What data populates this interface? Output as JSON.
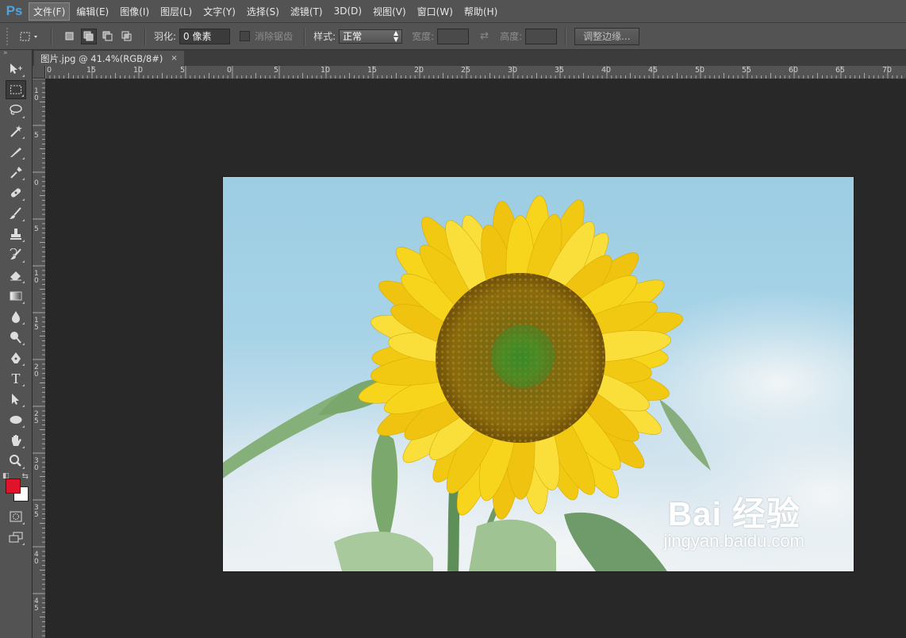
{
  "app": {
    "logo": "Ps",
    "menus": [
      "文件(F)",
      "编辑(E)",
      "图像(I)",
      "图层(L)",
      "文字(Y)",
      "选择(S)",
      "滤镜(T)",
      "3D(D)",
      "视图(V)",
      "窗口(W)",
      "帮助(H)"
    ]
  },
  "options": {
    "feather_label": "羽化:",
    "feather_value": "0 像素",
    "antialias_label": "消除锯齿",
    "style_label": "样式:",
    "style_value": "正常",
    "width_label": "宽度:",
    "height_label": "高度:",
    "refine_edge_label": "调整边缘..."
  },
  "panel_strip": {
    "collapse_glyph": "»"
  },
  "document": {
    "tab_title": "图片.jpg @ 41.4%(RGB/8#)",
    "close_glyph": "×"
  },
  "ruler": {
    "h_labels": [
      "0",
      "15",
      "10",
      "5",
      "0",
      "5",
      "10",
      "15",
      "20",
      "25",
      "30",
      "35",
      "40",
      "45",
      "50",
      "55",
      "60",
      "65",
      "70"
    ],
    "v_labels": [
      "1 0",
      "5",
      "0",
      "5",
      "1 0",
      "1 5",
      "2 0",
      "2 5",
      "3 0",
      "3 5",
      "4 0",
      "4 5"
    ]
  },
  "colors": {
    "foreground": "#e0132a",
    "background": "#ffffff",
    "accent": "#4fa3e0"
  },
  "watermark": {
    "logo_text": "Bai 经验",
    "site": "jingyan.baidu.com"
  }
}
